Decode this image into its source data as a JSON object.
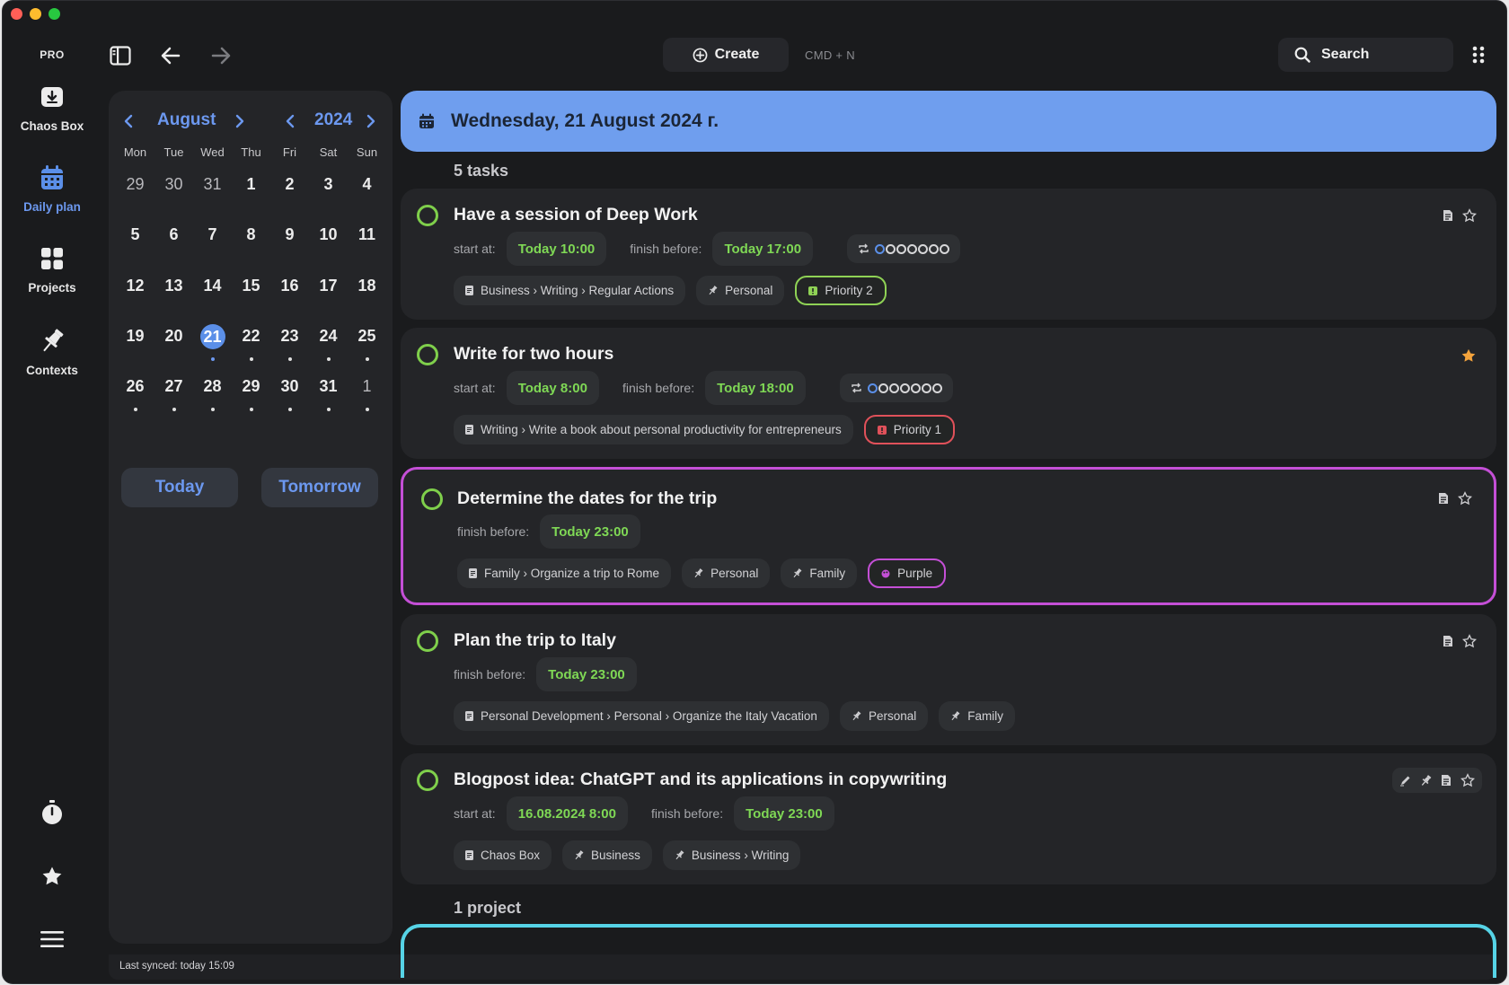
{
  "app": {
    "pro_label": "PRO"
  },
  "rail": {
    "items": [
      {
        "label": "Chaos Box",
        "icon": "inbox-icon"
      },
      {
        "label": "Daily plan",
        "icon": "calendar-icon"
      },
      {
        "label": "Projects",
        "icon": "grid-icon"
      },
      {
        "label": "Contexts",
        "icon": "pin-icon"
      }
    ],
    "bottom": [
      "timer-icon",
      "star-icon",
      "menu-icon"
    ]
  },
  "toolbar": {
    "create_label": "Create",
    "create_hint": "CMD + N",
    "search_label": "Search"
  },
  "calendar": {
    "month": "August",
    "year": "2024",
    "weekdays": [
      "Mon",
      "Tue",
      "Wed",
      "Thu",
      "Fri",
      "Sat",
      "Sun"
    ],
    "days": [
      {
        "n": "29",
        "m": true
      },
      {
        "n": "30",
        "m": true
      },
      {
        "n": "31",
        "m": true
      },
      {
        "n": "1"
      },
      {
        "n": "2"
      },
      {
        "n": "3"
      },
      {
        "n": "4"
      },
      {
        "n": "5"
      },
      {
        "n": "6"
      },
      {
        "n": "7"
      },
      {
        "n": "8"
      },
      {
        "n": "9"
      },
      {
        "n": "10"
      },
      {
        "n": "11"
      },
      {
        "n": "12"
      },
      {
        "n": "13"
      },
      {
        "n": "14"
      },
      {
        "n": "15"
      },
      {
        "n": "16"
      },
      {
        "n": "17"
      },
      {
        "n": "18"
      },
      {
        "n": "19"
      },
      {
        "n": "20"
      },
      {
        "n": "21",
        "today": true,
        "dot": true
      },
      {
        "n": "22",
        "dot": true
      },
      {
        "n": "23",
        "dot": true
      },
      {
        "n": "24",
        "dot": true
      },
      {
        "n": "25",
        "dot": true
      },
      {
        "n": "26",
        "dot": true
      },
      {
        "n": "27",
        "dot": true
      },
      {
        "n": "28",
        "dot": true
      },
      {
        "n": "29",
        "dot": true
      },
      {
        "n": "30",
        "dot": true
      },
      {
        "n": "31",
        "dot": true
      },
      {
        "n": "1",
        "m": true,
        "dot": true
      }
    ],
    "today_button": "Today",
    "tomorrow_button": "Tomorrow"
  },
  "status": {
    "last_synced": "Last synced: today 15:09"
  },
  "main": {
    "date_title": "Wednesday, 21 August 2024 г.",
    "tasks_count": "5 tasks",
    "projects_count": "1 project",
    "labels": {
      "start_at": "start at:",
      "finish_before": "finish before:"
    },
    "tasks": [
      {
        "title": "Have a session of Deep Work",
        "start": "Today 10:00",
        "finish": "Today 17:00",
        "tags": [
          "Business › Writing › Regular Actions",
          "Personal",
          "Priority 2"
        ]
      },
      {
        "title": "Write for two hours",
        "start": "Today 8:00",
        "finish": "Today 18:00",
        "tags": [
          "Writing › Write a book about personal productivity for entrepreneurs",
          "Priority 1"
        ]
      },
      {
        "title": "Determine the dates for the trip",
        "finish": "Today 23:00",
        "tags": [
          "Family › Organize a trip to Rome",
          "Personal",
          "Family",
          "Purple"
        ]
      },
      {
        "title": "Plan the trip to Italy",
        "finish": "Today 23:00",
        "tags": [
          "Personal Development › Personal › Organize the Italy Vacation",
          "Personal",
          "Family"
        ]
      },
      {
        "title": "Blogpost idea: ChatGPT and its applications in copywriting",
        "start": "16.08.2024 8:00",
        "finish": "Today 23:00",
        "tags": [
          "Chaos Box",
          "Business",
          "Business › Writing"
        ]
      }
    ]
  },
  "colors": {
    "accent": "#6c98ef",
    "check": "#7fcf4b",
    "time": "#7fd855",
    "priority2": "#8fd255",
    "priority1": "#e0515a",
    "purple": "#c44fd6",
    "star": "#f3a33c",
    "project": "#56d3e6"
  }
}
